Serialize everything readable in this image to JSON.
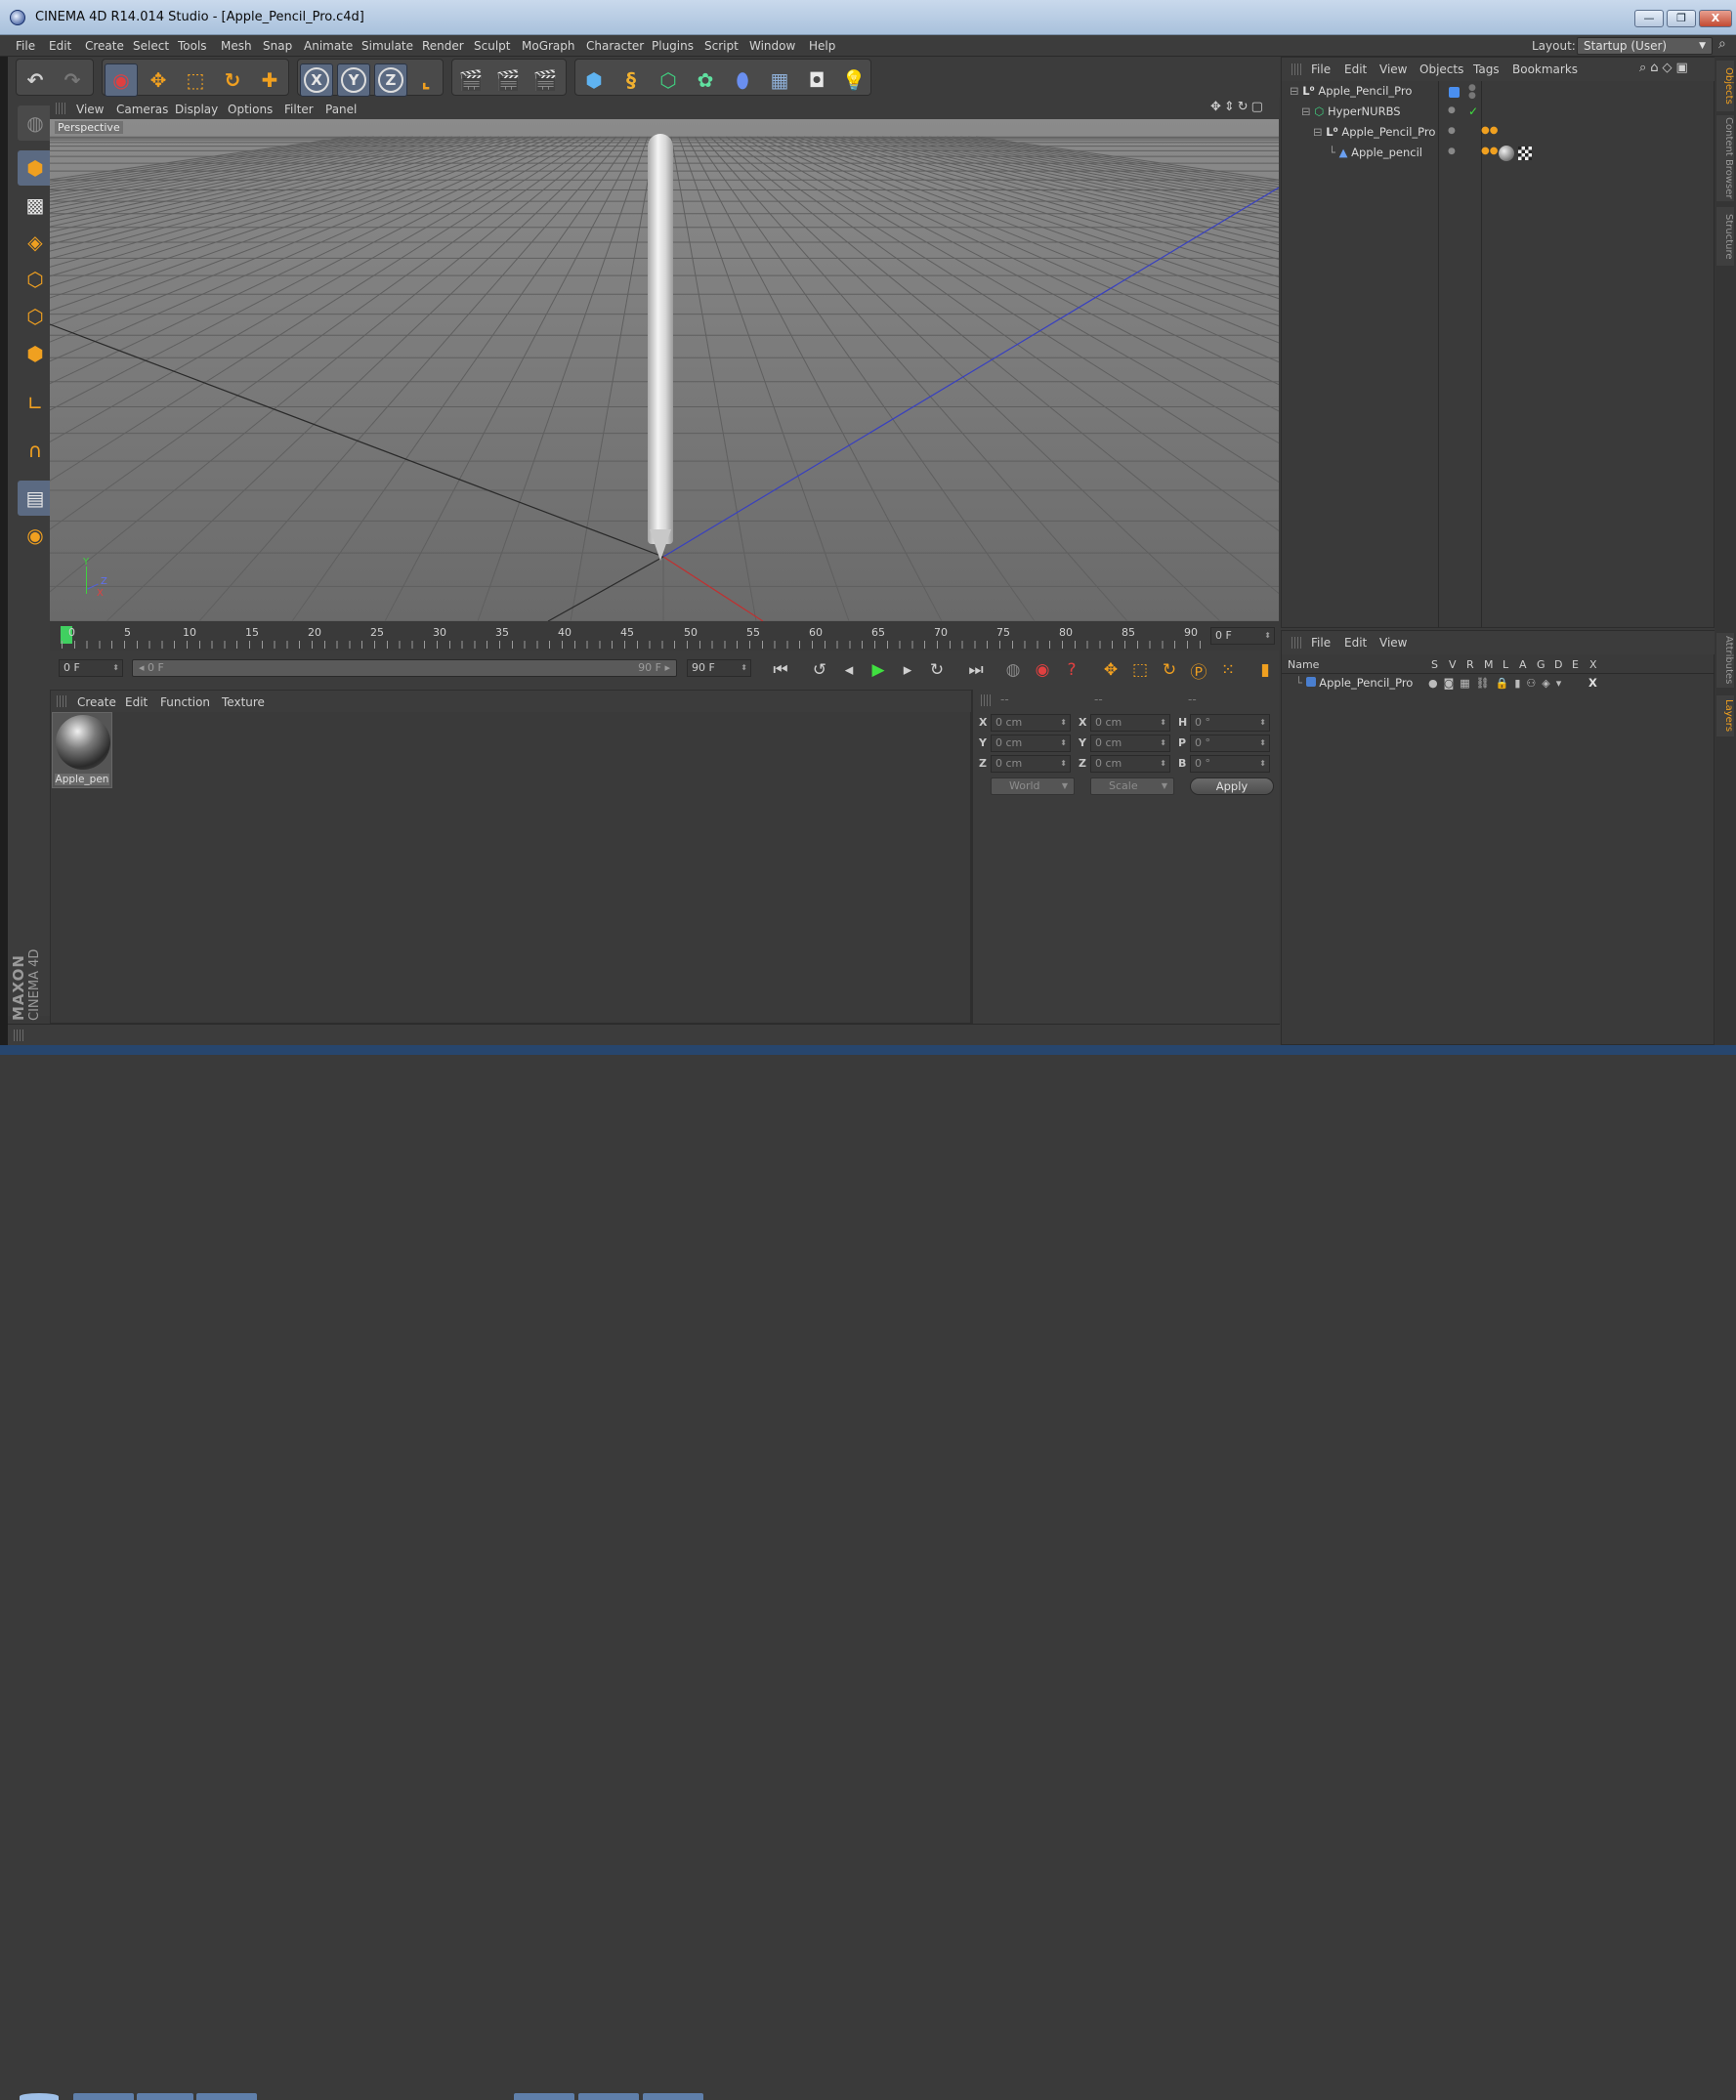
{
  "window": {
    "title": "CINEMA 4D R14.014 Studio - [Apple_Pencil_Pro.c4d]",
    "minimize": "—",
    "restore": "❐",
    "close": "X"
  },
  "menu": [
    "File",
    "Edit",
    "Create",
    "Select",
    "Tools",
    "Mesh",
    "Snap",
    "Animate",
    "Simulate",
    "Render",
    "Sculpt",
    "MoGraph",
    "Character",
    "Plugins",
    "Script",
    "Window",
    "Help"
  ],
  "layout": {
    "label": "Layout:",
    "value": "Startup (User)"
  },
  "toolbar": {
    "axis_x": "X",
    "axis_y": "Y",
    "axis_z": "Z",
    "accent": "#f0a020",
    "active_bg": "#5b6a82"
  },
  "viewport": {
    "menu": [
      "View",
      "Cameras",
      "Display",
      "Options",
      "Filter",
      "Panel"
    ],
    "label": "Perspective",
    "axis_y": "Y",
    "axis_z": "Z",
    "axis_x": "X"
  },
  "timeline": {
    "ticks": [
      "0",
      "5",
      "10",
      "15",
      "20",
      "25",
      "30",
      "35",
      "40",
      "45",
      "50",
      "55",
      "60",
      "65",
      "70",
      "75",
      "80",
      "85",
      "90"
    ],
    "current_frame": "0 F",
    "start_frame": "0 F",
    "range_start": "0 F",
    "range_end": "90 F",
    "end_frame": "90 F"
  },
  "materials": {
    "menu": [
      "Create",
      "Edit",
      "Function",
      "Texture"
    ],
    "items": [
      {
        "name": "Apple_pen"
      }
    ]
  },
  "coords": {
    "header": [
      "--",
      "--",
      "--"
    ],
    "rows": [
      {
        "a": "X",
        "pos": "0 cm",
        "b": "X",
        "size": "0 cm",
        "c": "H",
        "rot": "0 °"
      },
      {
        "a": "Y",
        "pos": "0 cm",
        "b": "Y",
        "size": "0 cm",
        "c": "P",
        "rot": "0 °"
      },
      {
        "a": "Z",
        "pos": "0 cm",
        "b": "Z",
        "size": "0 cm",
        "c": "B",
        "rot": "0 °"
      }
    ],
    "mode": "World",
    "transform": "Scale",
    "apply": "Apply"
  },
  "objects": {
    "menu": [
      "File",
      "Edit",
      "View",
      "Objects",
      "Tags",
      "Bookmarks"
    ],
    "tree": [
      {
        "name": "Apple_Pencil_Pro",
        "indent": 0
      },
      {
        "name": "HyperNURBS",
        "indent": 1
      },
      {
        "name": "Apple_Pencil_Pro",
        "indent": 2
      },
      {
        "name": "Apple_pencil",
        "indent": 3
      }
    ]
  },
  "layers": {
    "menu": [
      "File",
      "Edit",
      "View"
    ],
    "columns": [
      "Name",
      "S",
      "V",
      "R",
      "M",
      "L",
      "A",
      "G",
      "D",
      "E",
      "X"
    ],
    "rows": [
      {
        "name": "Apple_Pencil_Pro",
        "color": "#4a7fd0"
      }
    ]
  },
  "sidetabs": [
    "Objects",
    "Content Browser",
    "Structure",
    "Attributes",
    "Layers"
  ],
  "brand": {
    "maxon": "MAXON",
    "product": "CINEMA 4D"
  }
}
